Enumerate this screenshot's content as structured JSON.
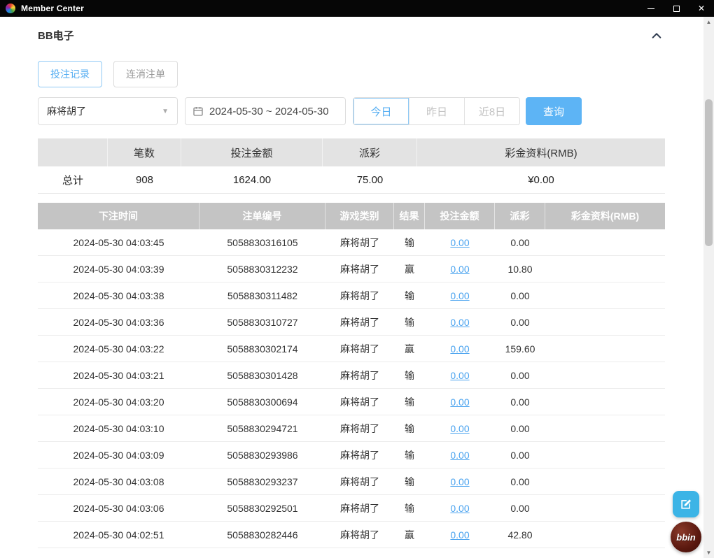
{
  "colors": {
    "accent_blue": "#56aef2",
    "link_blue": "#4aa3ef",
    "search_button_blue": "#5db4f5",
    "table_header_gray": "#c4c4c4",
    "summary_header_gray": "#e3e3e3",
    "titlebar_black": "#060606",
    "feedback_teal": "#3cb4e6",
    "brand_maroon": "#5a180f"
  },
  "titlebar": {
    "title": "Member Center"
  },
  "page": {
    "heading": "BB电子",
    "tabs": [
      {
        "label": "投注记录",
        "active": true
      },
      {
        "label": "连消注单",
        "active": false
      }
    ],
    "filters": {
      "game_select_value": "麻将胡了",
      "date_range_value": "2024-05-30 ~ 2024-05-30",
      "quick_buttons": [
        {
          "label": "今日",
          "active": true
        },
        {
          "label": "昨日",
          "active": false
        },
        {
          "label": "近8日",
          "active": false
        }
      ],
      "search_label": "查询"
    },
    "summary": {
      "headers": [
        "",
        "笔数",
        "投注金额",
        "派彩",
        "彩金资料(RMB)"
      ],
      "total_label": "总计",
      "count": "908",
      "bet_amount": "1624.00",
      "payout": "75.00",
      "bonus": "¥0.00"
    },
    "table": {
      "headers": [
        "下注时间",
        "注单编号",
        "游戏类别",
        "结果",
        "投注金额",
        "派彩",
        "彩金资料(RMB)"
      ],
      "rows": [
        {
          "time": "2024-05-30 04:03:45",
          "order": "5058830316105",
          "game": "麻将胡了",
          "result": "输",
          "bet": "0.00",
          "payout": "0.00",
          "bonus": ""
        },
        {
          "time": "2024-05-30 04:03:39",
          "order": "5058830312232",
          "game": "麻将胡了",
          "result": "赢",
          "bet": "0.00",
          "payout": "10.80",
          "bonus": ""
        },
        {
          "time": "2024-05-30 04:03:38",
          "order": "5058830311482",
          "game": "麻将胡了",
          "result": "输",
          "bet": "0.00",
          "payout": "0.00",
          "bonus": ""
        },
        {
          "time": "2024-05-30 04:03:36",
          "order": "5058830310727",
          "game": "麻将胡了",
          "result": "输",
          "bet": "0.00",
          "payout": "0.00",
          "bonus": ""
        },
        {
          "time": "2024-05-30 04:03:22",
          "order": "5058830302174",
          "game": "麻将胡了",
          "result": "赢",
          "bet": "0.00",
          "payout": "159.60",
          "bonus": ""
        },
        {
          "time": "2024-05-30 04:03:21",
          "order": "5058830301428",
          "game": "麻将胡了",
          "result": "输",
          "bet": "0.00",
          "payout": "0.00",
          "bonus": ""
        },
        {
          "time": "2024-05-30 04:03:20",
          "order": "5058830300694",
          "game": "麻将胡了",
          "result": "输",
          "bet": "0.00",
          "payout": "0.00",
          "bonus": ""
        },
        {
          "time": "2024-05-30 04:03:10",
          "order": "5058830294721",
          "game": "麻将胡了",
          "result": "输",
          "bet": "0.00",
          "payout": "0.00",
          "bonus": ""
        },
        {
          "time": "2024-05-30 04:03:09",
          "order": "5058830293986",
          "game": "麻将胡了",
          "result": "输",
          "bet": "0.00",
          "payout": "0.00",
          "bonus": ""
        },
        {
          "time": "2024-05-30 04:03:08",
          "order": "5058830293237",
          "game": "麻将胡了",
          "result": "输",
          "bet": "0.00",
          "payout": "0.00",
          "bonus": ""
        },
        {
          "time": "2024-05-30 04:03:06",
          "order": "5058830292501",
          "game": "麻将胡了",
          "result": "输",
          "bet": "0.00",
          "payout": "0.00",
          "bonus": ""
        },
        {
          "time": "2024-05-30 04:02:51",
          "order": "5058830282446",
          "game": "麻将胡了",
          "result": "赢",
          "bet": "0.00",
          "payout": "42.80",
          "bonus": ""
        }
      ]
    }
  },
  "floating": {
    "brand": "bbin"
  }
}
